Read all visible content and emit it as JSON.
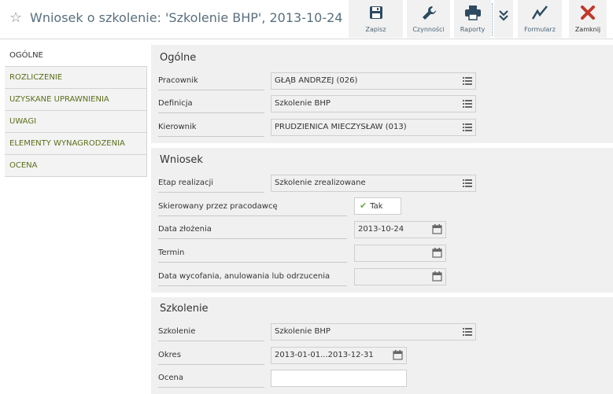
{
  "header": {
    "title": "Wniosek o szkolenie: 'Szkolenie BHP', 2013-10-24",
    "star_icon": "star-outline-icon"
  },
  "toolbar": {
    "save_label": "Zapisz",
    "actions_label": "Czynności",
    "reports_label": "Raporty",
    "form_label": "Formularz",
    "close_label": "Zamknij",
    "icons": {
      "save": "floppy-disk-icon",
      "actions": "wrench-icon",
      "reports": "printer-icon",
      "more": "double-chevron-down-icon",
      "form": "chart-line-icon",
      "close": "red-x-icon"
    },
    "close_color": "#c0392b"
  },
  "sidebar": {
    "items": [
      {
        "label": "OGÓLNE"
      },
      {
        "label": "ROZLICZENIE"
      },
      {
        "label": "UZYSKANE UPRAWNIENIA"
      },
      {
        "label": "UWAGI"
      },
      {
        "label": "ELEMENTY WYNAGRODZENIA"
      },
      {
        "label": "OCENA"
      }
    ]
  },
  "sections": {
    "ogolne": {
      "title": "Ogólne",
      "pracownik_label": "Pracownik",
      "pracownik_value": "GŁĄB ANDRZEJ (026)",
      "definicja_label": "Definicja",
      "definicja_value": "Szkolenie BHP",
      "kierownik_label": "Kierownik",
      "kierownik_value": "PRUDZIENICA MIECZYSŁAW (013)"
    },
    "wniosek": {
      "title": "Wniosek",
      "etap_label": "Etap realizacji",
      "etap_value": "Szkolenie zrealizowane",
      "skierowany_label": "Skierowany przez pracodawcę",
      "skierowany_value": "Tak",
      "data_zlozenia_label": "Data złożenia",
      "data_zlozenia_value": "2013-10-24",
      "termin_label": "Termin",
      "termin_value": "",
      "data_wycofania_label": "Data wycofania, anulowania lub odrzucenia",
      "data_wycofania_value": ""
    },
    "szkolenie": {
      "title": "Szkolenie",
      "szkolenie_label": "Szkolenie",
      "szkolenie_value": "Szkolenie BHP",
      "okres_label": "Okres",
      "okres_value": "2013-01-01...2013-12-31",
      "ocena_label": "Ocena",
      "ocena_value": ""
    }
  }
}
